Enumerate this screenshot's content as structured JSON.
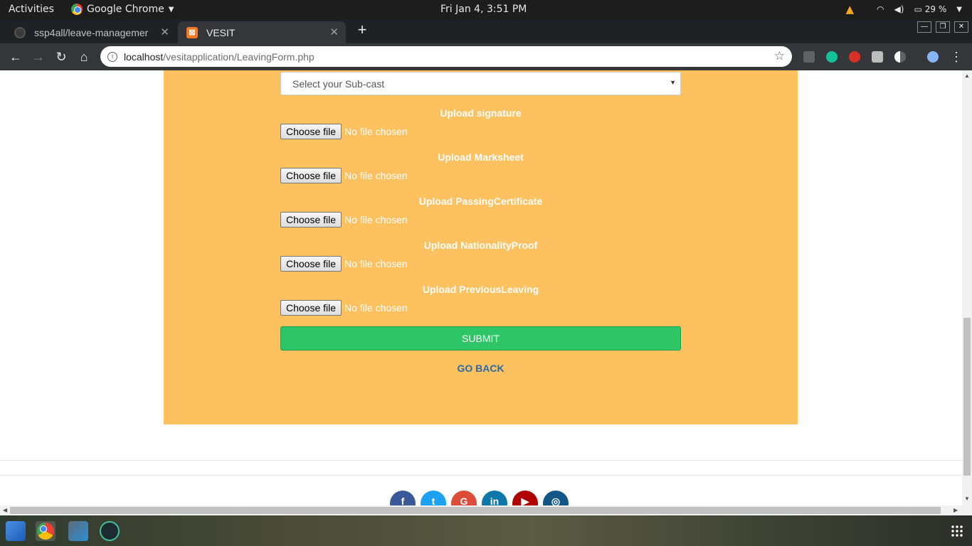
{
  "system_bar": {
    "activities": "Activities",
    "app_name": "Google Chrome",
    "clock": "Fri Jan  4,  3:51 PM",
    "battery": "29 %"
  },
  "browser": {
    "tabs": [
      {
        "title": "ssp4all/leave-managemer",
        "active": false
      },
      {
        "title": "VESIT",
        "active": true
      }
    ],
    "url_host": "localhost",
    "url_path": "/vesitapplication/LeavingForm.php"
  },
  "form": {
    "subcaste_select": "Select your Sub-cast",
    "uploads": [
      {
        "label": "Upload signature",
        "button": "Choose file",
        "status": "No file chosen"
      },
      {
        "label": "Upload Marksheet",
        "button": "Choose file",
        "status": "No file chosen"
      },
      {
        "label": "Upload PassingCertificate",
        "button": "Choose file",
        "status": "No file chosen"
      },
      {
        "label": "Upload NationalityProof",
        "button": "Choose file",
        "status": "No file chosen"
      },
      {
        "label": "Upload PreviousLeaving",
        "button": "Choose file",
        "status": "No file chosen"
      }
    ],
    "submit_label": "SUBMIT",
    "go_back_label": "GO BACK"
  },
  "footer": {
    "social": [
      {
        "name": "facebook",
        "glyph": "f",
        "color": "#3b5998"
      },
      {
        "name": "twitter",
        "glyph": "t",
        "color": "#1da1f2"
      },
      {
        "name": "google",
        "glyph": "G",
        "color": "#dd4b39"
      },
      {
        "name": "linkedin",
        "glyph": "in",
        "color": "#0e76a8"
      },
      {
        "name": "youtube",
        "glyph": "▶",
        "color": "#b00000"
      },
      {
        "name": "instagram",
        "glyph": "◎",
        "color": "#125688"
      }
    ]
  },
  "colors": {
    "form_background": "#fec160",
    "submit_green": "#2dc566",
    "go_back_blue": "#2c6aa6"
  }
}
